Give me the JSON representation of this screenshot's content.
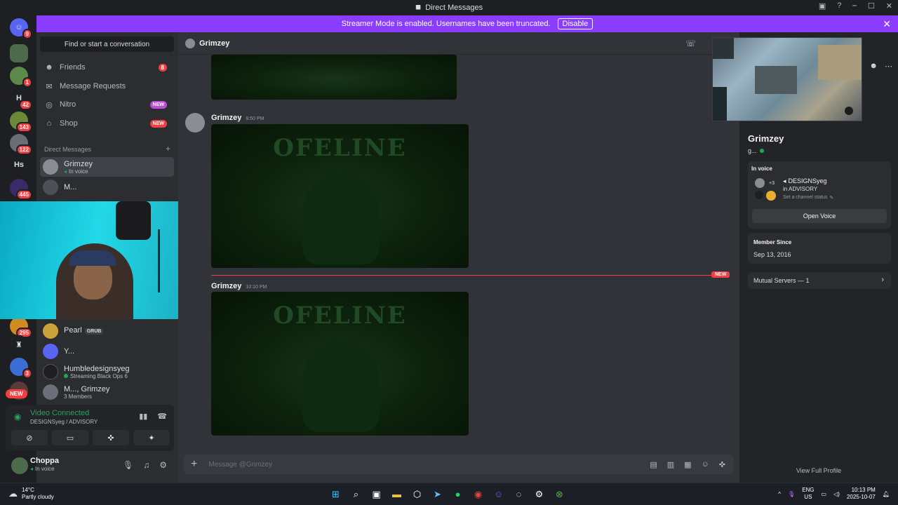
{
  "window": {
    "title": "Direct Messages",
    "controls": [
      "⎯",
      "☐",
      "✕"
    ]
  },
  "banner": {
    "text": "Streamer Mode is enabled. Usernames have been truncated.",
    "disable_label": "Disable",
    "accent": "#8b3dff"
  },
  "rail": {
    "servers": [
      {
        "label": "",
        "badge": "9"
      },
      {
        "label": "",
        "badge": ""
      },
      {
        "label": "",
        "badge": "1"
      },
      {
        "label": "H",
        "badge": "42"
      },
      {
        "label": "",
        "badge": "143"
      },
      {
        "label": "",
        "badge": "122"
      },
      {
        "label": "Hs",
        "badge": ""
      },
      {
        "label": "",
        "badge": "445"
      },
      {
        "label": "",
        "badge": "295"
      },
      {
        "label": "",
        "badge": ""
      },
      {
        "label": "",
        "badge": "3"
      },
      {
        "label": "",
        "badge": "NEW"
      }
    ]
  },
  "sidebar": {
    "find_placeholder": "Find or start a conversation",
    "nav": [
      {
        "label": "Friends",
        "icon": "friends-icon",
        "count": "8"
      },
      {
        "label": "Message Requests",
        "icon": "mail-icon",
        "count": ""
      },
      {
        "label": "Nitro",
        "icon": "nitro-icon",
        "tag": "NEW"
      },
      {
        "label": "Shop",
        "icon": "shop-icon",
        "tag": "NEW"
      }
    ],
    "dm_header": "Direct Messages",
    "dms_top": [
      {
        "name": "Grimzey",
        "sub": "In voice"
      },
      {
        "name": "M...",
        "sub": ""
      }
    ],
    "dms_bottom": [
      {
        "name": "Pearl",
        "tag": "GRUB",
        "sub": ""
      },
      {
        "name": "Y...",
        "sub": ""
      },
      {
        "name": "Humbledesignsyeg",
        "sub": "Streaming Black Ops 6"
      },
      {
        "name": "M..., Grimzey",
        "sub": "3 Members"
      }
    ]
  },
  "voice": {
    "status": "Video Connected",
    "channel": "DESIGNSyeg / ADVISORY"
  },
  "user": {
    "name": "Choppa",
    "status": "In voice"
  },
  "chat": {
    "header_name": "Grimzey",
    "messages": [
      {
        "author": "Grimzey",
        "time": "9:50 PM",
        "image_text": "OFELINE"
      },
      {
        "author": "Grimzey",
        "time": "10:10 PM",
        "image_text": "OFELINE"
      }
    ],
    "top_image_text": "",
    "new_label": "NEW",
    "composer_placeholder": "Message @Grimzey"
  },
  "profile": {
    "name": "Grimzey",
    "sub": "g...",
    "in_voice_label": "In voice",
    "voice_server": "DESIGNSyeg",
    "voice_channel": "in ADVISORY",
    "voice_plus": "+3",
    "channel_status": "Set a channel status",
    "open_voice": "Open Voice",
    "member_since_label": "Member Since",
    "member_since": "Sep 13, 2016",
    "mutual_servers": "Mutual Servers — 1",
    "view_full": "View Full Profile"
  },
  "taskbar": {
    "temp": "14°C",
    "weather": "Partly cloudy",
    "lang1": "ENG",
    "lang2": "US",
    "time": "10:13 PM",
    "date": "2025-10-07"
  }
}
